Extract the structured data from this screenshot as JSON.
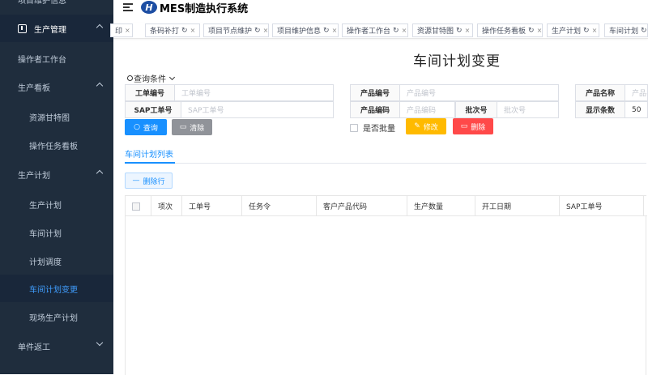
{
  "sidebar": {
    "top_partial": "项目维护信息",
    "items": [
      {
        "label": "生产管理",
        "level": 0,
        "expanded": true
      },
      {
        "label": "操作者工作台",
        "level": 1
      },
      {
        "label": "生产看板",
        "level": 1,
        "expanded": true
      },
      {
        "label": "资源甘特图",
        "level": 2
      },
      {
        "label": "操作任务看板",
        "level": 2
      },
      {
        "label": "生产计划",
        "level": 1,
        "expanded": true
      },
      {
        "label": "生产计划",
        "level": 2
      },
      {
        "label": "车间计划",
        "level": 2
      },
      {
        "label": "计划调度",
        "level": 2
      },
      {
        "label": "车间计划变更",
        "level": 2,
        "active": true
      },
      {
        "label": "现场生产计划",
        "level": 2
      },
      {
        "label": "单件返工",
        "level": 1,
        "expanded": false
      }
    ]
  },
  "header": {
    "logo_mark": "H",
    "logo_text": "MES制造执行系统"
  },
  "tags": [
    {
      "label": "印"
    },
    {
      "label": "条码补打"
    },
    {
      "label": "项目节点维护"
    },
    {
      "label": "项目维护信息"
    },
    {
      "label": "操作者工作台"
    },
    {
      "label": "资源甘特图"
    },
    {
      "label": "操作任务看板"
    },
    {
      "label": "生产计划"
    },
    {
      "label": "车间计划"
    }
  ],
  "page": {
    "title": "车间计划变更",
    "query_toggle": "查询条件"
  },
  "form": {
    "order_no": {
      "label": "工单编号",
      "placeholder": "工单编号"
    },
    "sap_order_no": {
      "label": "SAP工单号",
      "placeholder": "SAP工单号"
    },
    "product_no_a": {
      "label": "产品编号",
      "placeholder": "产品编号"
    },
    "product_code": {
      "label": "产品编码",
      "placeholder": "产品编码"
    },
    "batch_no": {
      "label": "批次号",
      "placeholder": "批次号"
    },
    "product_name": {
      "label": "产品名称",
      "placeholder": "产品名称"
    },
    "display_count": {
      "label": "显示条数",
      "value": "50"
    }
  },
  "buttons": {
    "query": "查询",
    "clear": "清除",
    "batch_label": "是否批量",
    "edit": "修改",
    "delete": "删除",
    "delete_row": "删除行"
  },
  "tab": {
    "label": "车间计划列表"
  },
  "table": {
    "columns": [
      "项次",
      "工单号",
      "任务令",
      "客户产品代码",
      "生产数量",
      "开工日期",
      "SAP工单号"
    ]
  }
}
